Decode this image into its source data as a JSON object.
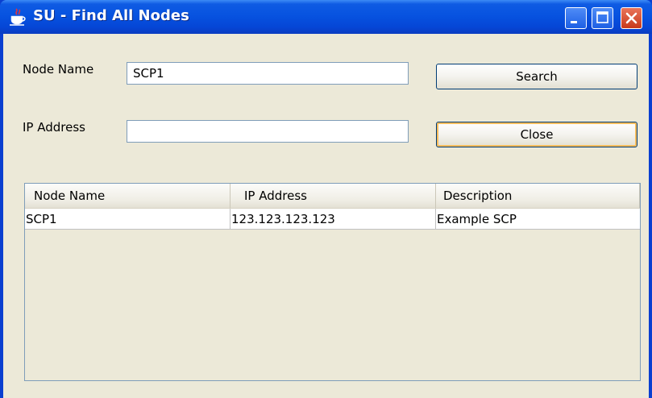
{
  "window": {
    "title": "SU - Find All Nodes"
  },
  "form": {
    "node_name_label": "Node Name",
    "node_name_value": "SCP1",
    "ip_address_label": "IP Address",
    "ip_address_value": ""
  },
  "buttons": {
    "search_label": "Search",
    "close_label": "Close"
  },
  "table": {
    "columns": [
      "Node Name",
      "IP Address",
      "Description"
    ],
    "rows": [
      [
        "SCP1",
        "123.123.123.123",
        "Example SCP"
      ]
    ]
  },
  "icons": {
    "app_icon": "java-coffee-cup-icon",
    "minimize": "minimize-icon",
    "maximize": "maximize-icon",
    "close": "close-icon"
  },
  "colors": {
    "titlebar": "#0753e0",
    "client_bg": "#ece9d8",
    "button_focus": "#f6bc5c",
    "close_button": "#c8391b"
  }
}
